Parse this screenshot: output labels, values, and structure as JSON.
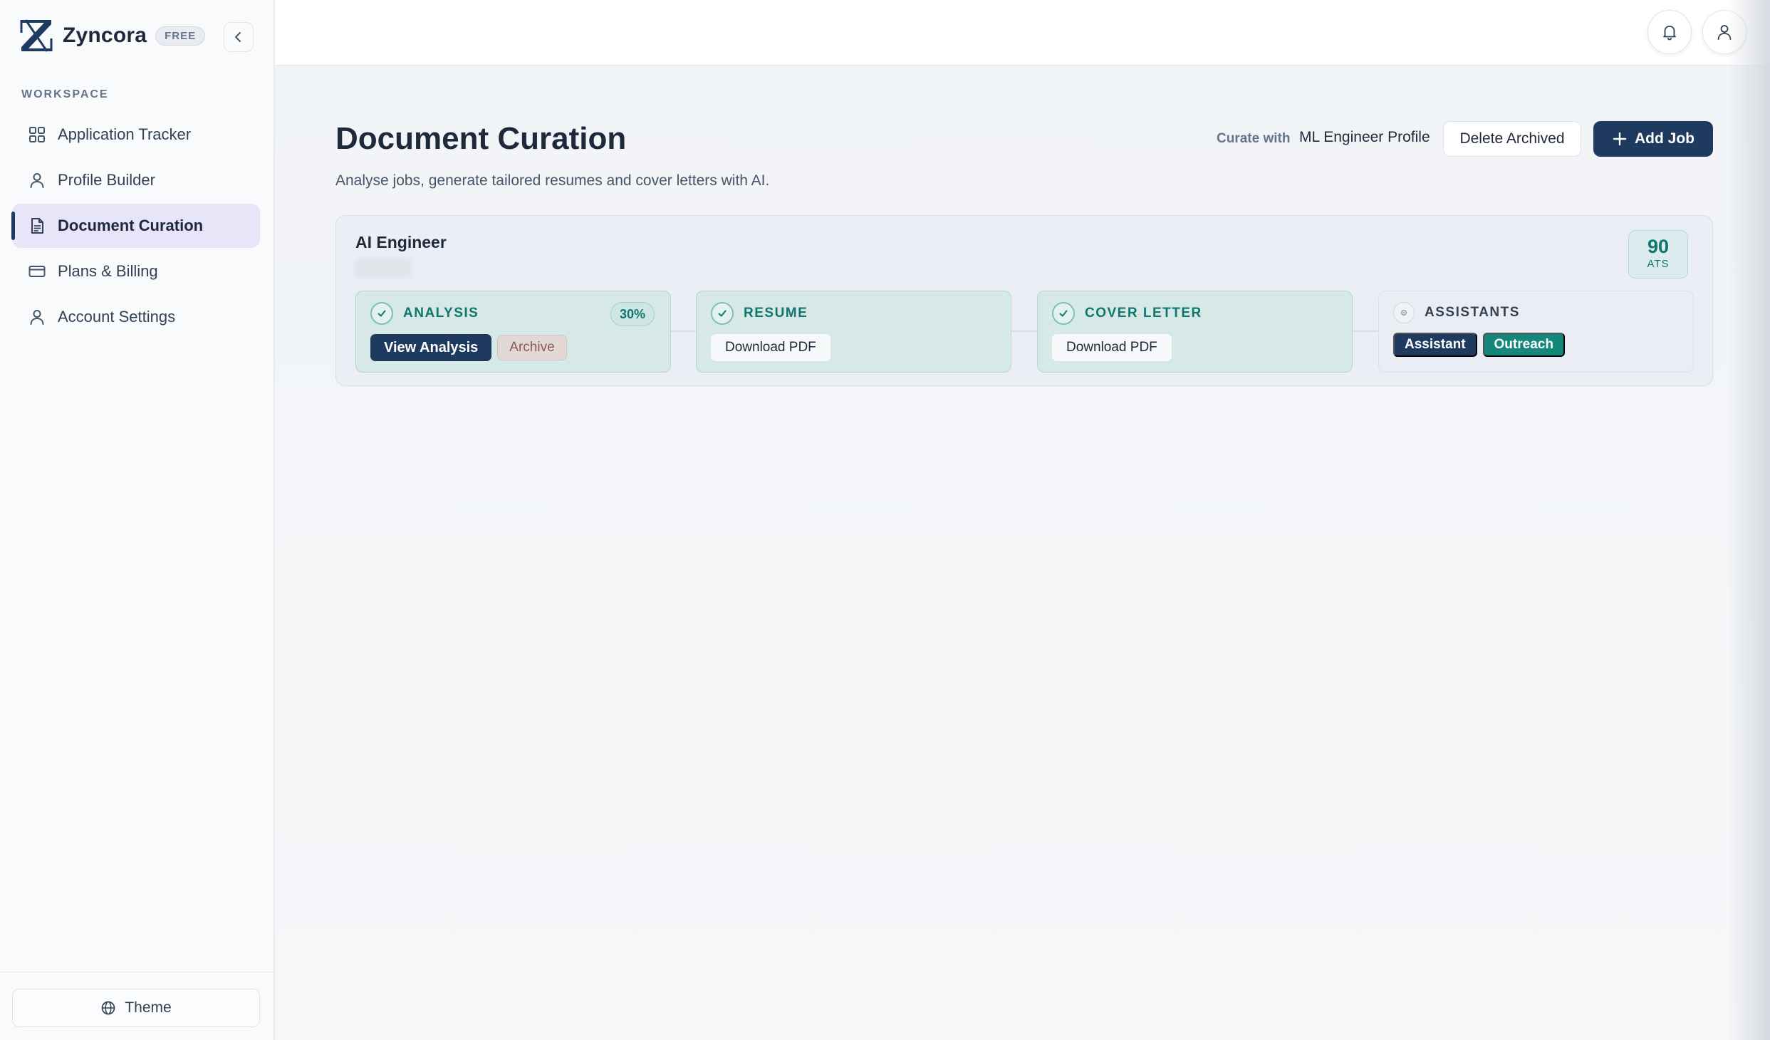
{
  "brand": {
    "name": "Zyncora",
    "plan_badge": "FREE"
  },
  "sidebar": {
    "section_label": "WORKSPACE",
    "items": [
      {
        "label": "Application Tracker",
        "icon": "grid-icon",
        "active": false
      },
      {
        "label": "Profile Builder",
        "icon": "user-icon",
        "active": false
      },
      {
        "label": "Document Curation",
        "icon": "document-icon",
        "active": true
      },
      {
        "label": "Plans & Billing",
        "icon": "credit-card-icon",
        "active": false
      },
      {
        "label": "Account Settings",
        "icon": "user-icon",
        "active": false
      }
    ],
    "theme_label": "Theme"
  },
  "header": {
    "icons": [
      "bell-icon",
      "user-icon"
    ]
  },
  "main": {
    "title": "Document Curation",
    "subtitle": "Analyse jobs, generate tailored resumes and cover letters with AI.",
    "curate_label": "Curate with",
    "curate_profile": "ML Engineer Profile",
    "delete_archived_label": "Delete Archived",
    "add_job_label": "Add Job"
  },
  "job": {
    "title": "AI Engineer",
    "ats_score": "90",
    "ats_label": "ATS",
    "steps": {
      "analysis": {
        "name": "ANALYSIS",
        "percent": "30%",
        "view_label": "View Analysis",
        "archive_label": "Archive",
        "status": "done"
      },
      "resume": {
        "name": "RESUME",
        "download_label": "Download PDF",
        "status": "done"
      },
      "cover_letter": {
        "name": "COVER LETTER",
        "download_label": "Download PDF",
        "status": "done"
      },
      "assistants": {
        "name": "ASSISTANTS",
        "assistant_label": "Assistant",
        "outreach_label": "Outreach",
        "status": "pending"
      }
    }
  },
  "colors": {
    "primary_navy": "#1e3a5f",
    "teal": "#0f766e",
    "teal_button": "#13877a",
    "active_nav_bg": "#e7e5f7"
  }
}
